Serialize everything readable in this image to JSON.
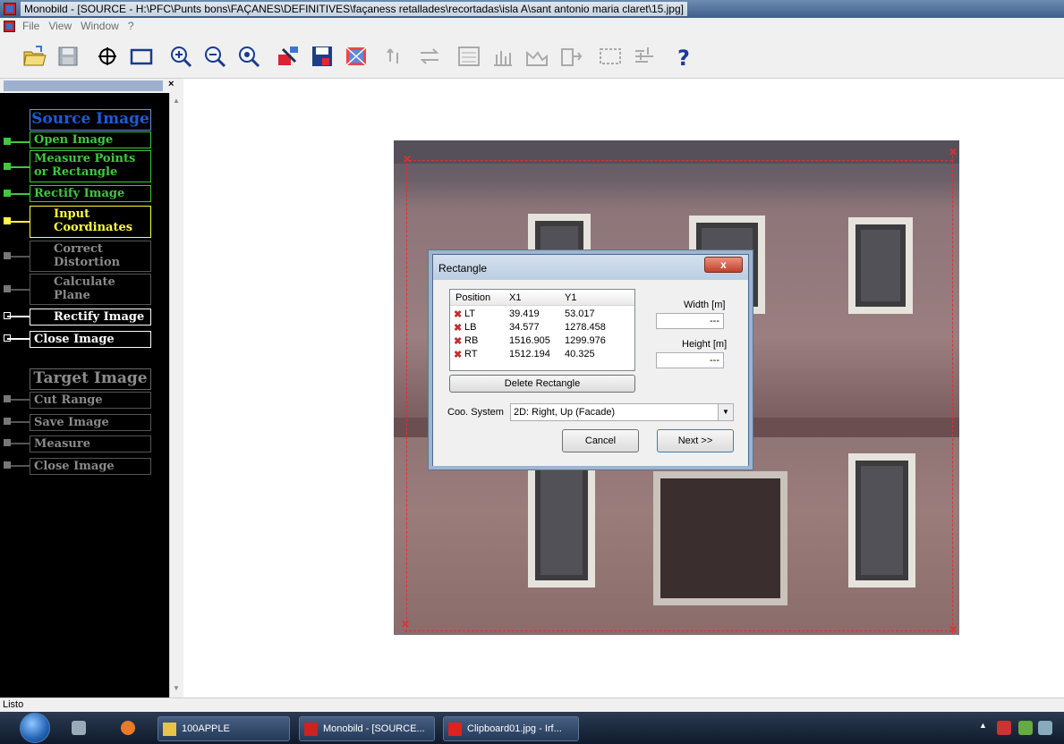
{
  "window": {
    "title": "Monobild - [SOURCE - H:\\PFC\\Punts bons\\FAÇANES\\DEFINITIVES\\façaness retallades\\recortadas\\isla A\\sant antonio maria claret\\15.jpg]"
  },
  "menu": {
    "items": [
      "File",
      "View",
      "Window",
      "?"
    ]
  },
  "toolbar": {
    "buttons": [
      "open-folder-icon",
      "save-disk-icon",
      "crosshair-icon",
      "rectangle-icon",
      "zoom-in-icon",
      "zoom-out-icon",
      "zoom-100-icon",
      "tools-icon",
      "save-image-icon",
      "rectify-icon",
      "undo-icon",
      "redo-icon",
      "report-icon",
      "chart-icon",
      "measure-icon",
      "export-icon",
      "select-rect-icon",
      "settings-icon",
      "help-icon"
    ]
  },
  "panel": {
    "close": "×",
    "source_title": "Source Image",
    "target_title": "Target Image",
    "steps": [
      {
        "label": "Open Image",
        "state": "done"
      },
      {
        "label": "Measure Points or Rectangle",
        "state": "done"
      },
      {
        "label": "Rectify Image",
        "state": "done"
      },
      {
        "label": "Input Coordinates",
        "state": "active"
      },
      {
        "label": "Correct Distortion",
        "state": "disabled"
      },
      {
        "label": "Calculate Plane",
        "state": "disabled"
      },
      {
        "label": "Rectify Image",
        "state": "enabled"
      },
      {
        "label": "Close Image",
        "state": "enabled"
      }
    ],
    "target_steps": [
      {
        "label": "Cut Range",
        "state": "disabled"
      },
      {
        "label": "Save Image",
        "state": "disabled"
      },
      {
        "label": "Measure",
        "state": "disabled"
      },
      {
        "label": "Close Image",
        "state": "disabled"
      }
    ]
  },
  "dialog": {
    "title": "Rectangle",
    "close": "x",
    "columns": [
      "Position",
      "X1",
      "Y1"
    ],
    "rows": [
      {
        "pos": "LT",
        "x": "39.419",
        "y": "53.017"
      },
      {
        "pos": "LB",
        "x": "34.577",
        "y": "1278.458"
      },
      {
        "pos": "RB",
        "x": "1516.905",
        "y": "1299.976"
      },
      {
        "pos": "RT",
        "x": "1512.194",
        "y": "40.325"
      }
    ],
    "delete_label": "Delete Rectangle",
    "width_label": "Width [m]",
    "width_value": "---",
    "height_label": "Height [m]",
    "height_value": "---",
    "coo_label": "Coo. System",
    "coo_value": "2D: Right, Up (Facade)",
    "cancel_label": "Cancel",
    "next_label": "Next >>"
  },
  "status": {
    "text": "Listo"
  },
  "taskbar": {
    "tasks": [
      "100APPLE",
      "Monobild - [SOURCE...",
      "Clipboard01.jpg - Irf..."
    ]
  },
  "colors": {
    "done": "#3ec93e",
    "active": "#ffff40",
    "disabled": "#8a8a8a",
    "enabled": "#ffffff",
    "accent": "#1e5bd6"
  }
}
